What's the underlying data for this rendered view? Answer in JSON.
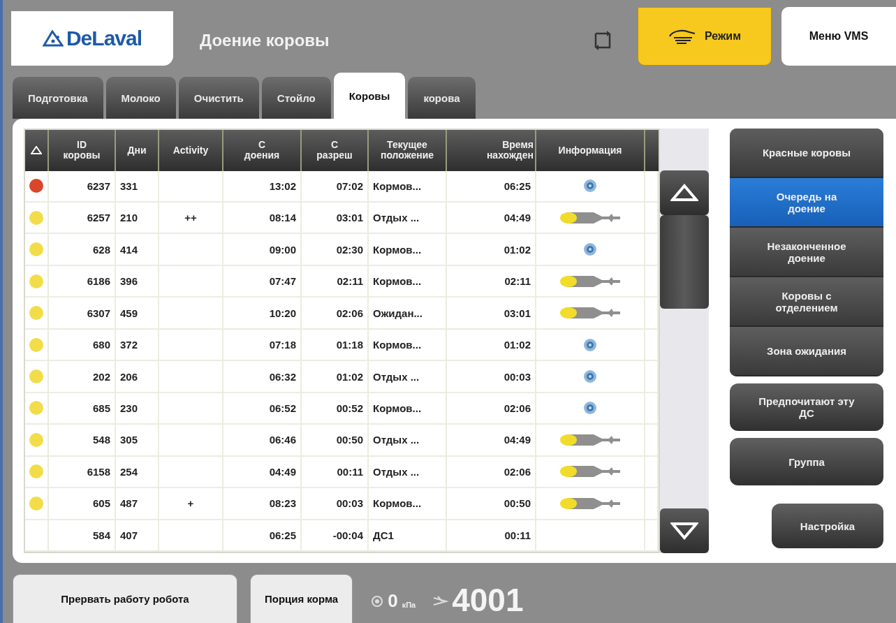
{
  "header": {
    "logo": "DeLaval",
    "title": "Доение коровы",
    "mode_button": "Режим",
    "menu_button": "Меню VMS"
  },
  "tabs": [
    {
      "label": "Подготовка",
      "selected": false
    },
    {
      "label": "Молоко",
      "selected": false
    },
    {
      "label": "Очистить",
      "selected": false
    },
    {
      "label": "Стойло",
      "selected": false
    },
    {
      "label": "Коровы",
      "selected": true
    },
    {
      "label": "корова",
      "selected": false
    }
  ],
  "table": {
    "columns": [
      {
        "lines": [
          "ID",
          "коровы"
        ]
      },
      {
        "lines": [
          "Дни"
        ]
      },
      {
        "lines": [
          "Activity"
        ]
      },
      {
        "lines": [
          "С",
          "доения"
        ]
      },
      {
        "lines": [
          "С",
          "разреш"
        ]
      },
      {
        "lines": [
          "Текущее",
          "положение"
        ]
      },
      {
        "lines": [
          "Время",
          "нахожден"
        ]
      },
      {
        "lines": [
          "Информация"
        ]
      }
    ],
    "rows": [
      {
        "color": "#d9462a",
        "id": "6237",
        "days": "331",
        "since_milking": "13:02",
        "since_permission": "07:02",
        "location": "Кормов...",
        "time": "06:25",
        "info": {
          "kind": "sensor"
        }
      },
      {
        "color": "#f2dc4a",
        "id": "6257",
        "days": "210",
        "activity": "++",
        "since_milking": "08:14",
        "since_permission": "03:01",
        "location": "Отдых ...",
        "time": "04:49",
        "info": {
          "kind": "teat-cup"
        }
      },
      {
        "color": "#f2dc4a",
        "id": "628",
        "days": "414",
        "since_milking": "09:00",
        "since_permission": "02:30",
        "location": "Кормов...",
        "time": "01:02",
        "info": {
          "kind": "sensor"
        }
      },
      {
        "color": "#f2dc4a",
        "id": "6186",
        "days": "396",
        "since_milking": "07:47",
        "since_permission": "02:11",
        "location": "Кормов...",
        "time": "02:11",
        "info": {
          "kind": "teat-cup"
        }
      },
      {
        "color": "#f2dc4a",
        "id": "6307",
        "days": "459",
        "since_milking": "10:20",
        "since_permission": "02:06",
        "location": "Ожидан...",
        "time": "03:01",
        "info": {
          "kind": "teat-cup"
        }
      },
      {
        "color": "#f2dc4a",
        "id": "680",
        "days": "372",
        "since_milking": "07:18",
        "since_permission": "01:18",
        "location": "Кормов...",
        "time": "01:02",
        "info": {
          "kind": "sensor"
        }
      },
      {
        "color": "#f2dc4a",
        "id": "202",
        "days": "206",
        "since_milking": "06:32",
        "since_permission": "01:02",
        "location": "Отдых ...",
        "time": "00:03",
        "info": {
          "kind": "sensor"
        }
      },
      {
        "color": "#f2dc4a",
        "id": "685",
        "days": "230",
        "since_milking": "06:52",
        "since_permission": "00:52",
        "location": "Кормов...",
        "time": "02:06",
        "info": {
          "kind": "sensor"
        }
      },
      {
        "color": "#f2dc4a",
        "id": "548",
        "days": "305",
        "since_milking": "06:46",
        "since_permission": "00:50",
        "location": "Отдых ...",
        "time": "04:49",
        "info": {
          "kind": "teat-cup"
        }
      },
      {
        "color": "#f2dc4a",
        "id": "6158",
        "days": "254",
        "since_milking": "04:49",
        "since_permission": "00:11",
        "location": "Отдых ...",
        "time": "02:06",
        "info": {
          "kind": "teat-cup"
        }
      },
      {
        "color": "#f2dc4a",
        "id": "605",
        "days": "487",
        "activity": "+",
        "since_milking": "08:23",
        "since_permission": "00:03",
        "location": "Кормов...",
        "time": "00:50",
        "info": {
          "kind": "teat-cup"
        }
      },
      {
        "id": "584",
        "days": "407",
        "since_milking": "06:25",
        "since_permission": "-00:04",
        "location": "ДС1",
        "time": "00:11"
      }
    ]
  },
  "filters": [
    {
      "label": "Красные коровы",
      "selected": false
    },
    {
      "label": "Очередь на доение",
      "selected": true
    },
    {
      "label": "Незаконченное доение",
      "selected": false
    },
    {
      "label": "Коровы с отделением",
      "selected": false
    },
    {
      "label": "Зона ожидания",
      "selected": false
    }
  ],
  "side_buttons": [
    {
      "label": "Предпочитают эту ДС",
      "kind": "wide"
    },
    {
      "label": "Группа",
      "kind": "wide"
    },
    {
      "label": "Настройка",
      "kind": "narrow"
    }
  ],
  "footer": {
    "buttons": [
      "Прервать работу робота",
      "Порция корма"
    ],
    "vacuum": "0",
    "vacuum_unit": "кПа",
    "robot_number": "4001"
  }
}
